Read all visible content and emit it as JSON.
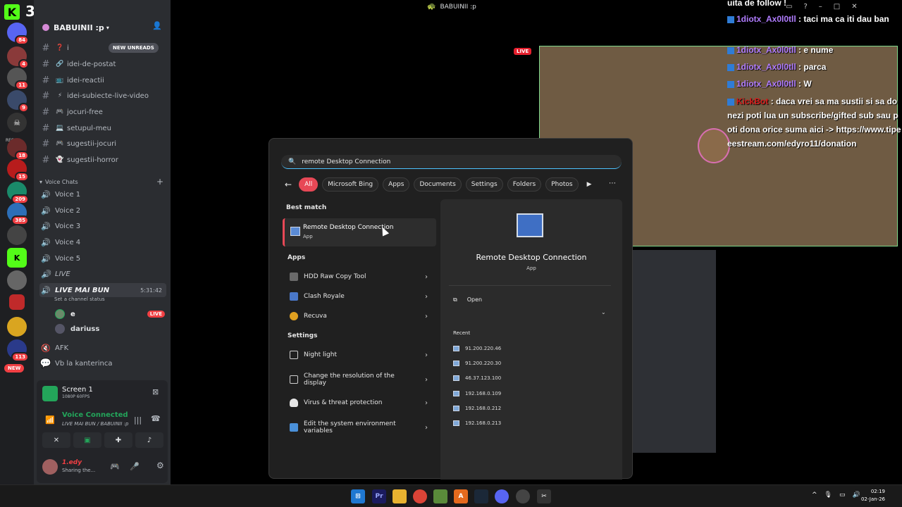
{
  "window": {
    "title": "BABUINII :p"
  },
  "rail": {
    "logo_text": "3",
    "badges": [
      "84",
      "4",
      "11",
      "9",
      "18",
      "15",
      "209",
      "385",
      "113"
    ],
    "resell_label": "RESELL",
    "new_label": "NEW"
  },
  "server": {
    "name": "BABUINII :p",
    "new_unreads": "NEW UNREADS",
    "text_channels": [
      {
        "name": "i",
        "emoji": "❓"
      },
      {
        "name": "idei-de-postat",
        "emoji": "🔗"
      },
      {
        "name": "idei-reactii",
        "emoji": "📺"
      },
      {
        "name": "idei-subiecte-live-video",
        "emoji": "⚡"
      },
      {
        "name": "jocuri-free",
        "emoji": "🎮"
      },
      {
        "name": "setupul-meu",
        "emoji": "💻"
      },
      {
        "name": "sugestii-jocuri",
        "emoji": "🎮"
      },
      {
        "name": "sugestii-horror",
        "emoji": "👻"
      }
    ],
    "voice_category": "Voice Chats",
    "voice_channels": [
      "Voice 1",
      "Voice 2",
      "Voice 3",
      "Voice 4",
      "Voice 5",
      "LIVE"
    ],
    "live_channel": {
      "name": "LIVE MAI BUN",
      "timer": "5:31:42",
      "status": "Set a channel status"
    },
    "members": [
      {
        "name": "e",
        "badge": "LIVE"
      },
      {
        "name": "dariuss"
      }
    ],
    "afk_channel": "AFK",
    "text_channel_last": "Vb la kanterinca"
  },
  "voice_panel": {
    "screen_title": "Screen 1",
    "screen_quality": "1080P 60FPS",
    "status": "Voice Connected",
    "location": "LIVE MAI BUN / BABUINII :p",
    "user_name": "1.edy",
    "user_status": "Sharing the..."
  },
  "stream": {
    "live_label": "LIVE"
  },
  "chat": {
    "lines": [
      {
        "user": "",
        "text": "uita de follow !"
      },
      {
        "user": "1diotx_Ax0l0tll",
        "text": ": taci ma ca iti dau ban"
      },
      {
        "user": "1diotx_Ax0l0tll",
        "text": ": e nume"
      },
      {
        "user": "1diotx_Ax0l0tll",
        "text": ": parca"
      },
      {
        "user": "1diotx_Ax0l0tll",
        "text": ": W"
      },
      {
        "user": "KickBot",
        "text": ": daca vrei sa ma sustii si sa donezi poti lua un subscribe/gifted sub sau poti dona orice suma aici -> https://www.tipeeestream.com/edyro11/donation"
      }
    ]
  },
  "search": {
    "query": "remote Desktop Connection",
    "filters": [
      "All",
      "Microsoft Bing",
      "Apps",
      "Documents",
      "Settings",
      "Folders",
      "Photos"
    ],
    "best_match_label": "Best match",
    "best_match": {
      "title": "Remote Desktop Connection",
      "subtitle": "App"
    },
    "apps_label": "Apps",
    "apps": [
      "HDD Raw Copy Tool",
      "Clash Royale",
      "Recuva"
    ],
    "settings_label": "Settings",
    "settings": [
      "Night light",
      "Change the resolution of the display",
      "Virus & threat protection",
      "Edit the system environment variables"
    ],
    "detail": {
      "title": "Remote Desktop Connection",
      "subtitle": "App",
      "open_label": "Open",
      "recent_label": "Recent",
      "recent": [
        "91.200.220.46",
        "91.200.220.30",
        "46.37.123.100",
        "192.168.0.109",
        "192.168.0.212",
        "192.168.0.213"
      ]
    }
  },
  "taskbar": {
    "time": "02:19",
    "date": "02-Jan-26"
  }
}
